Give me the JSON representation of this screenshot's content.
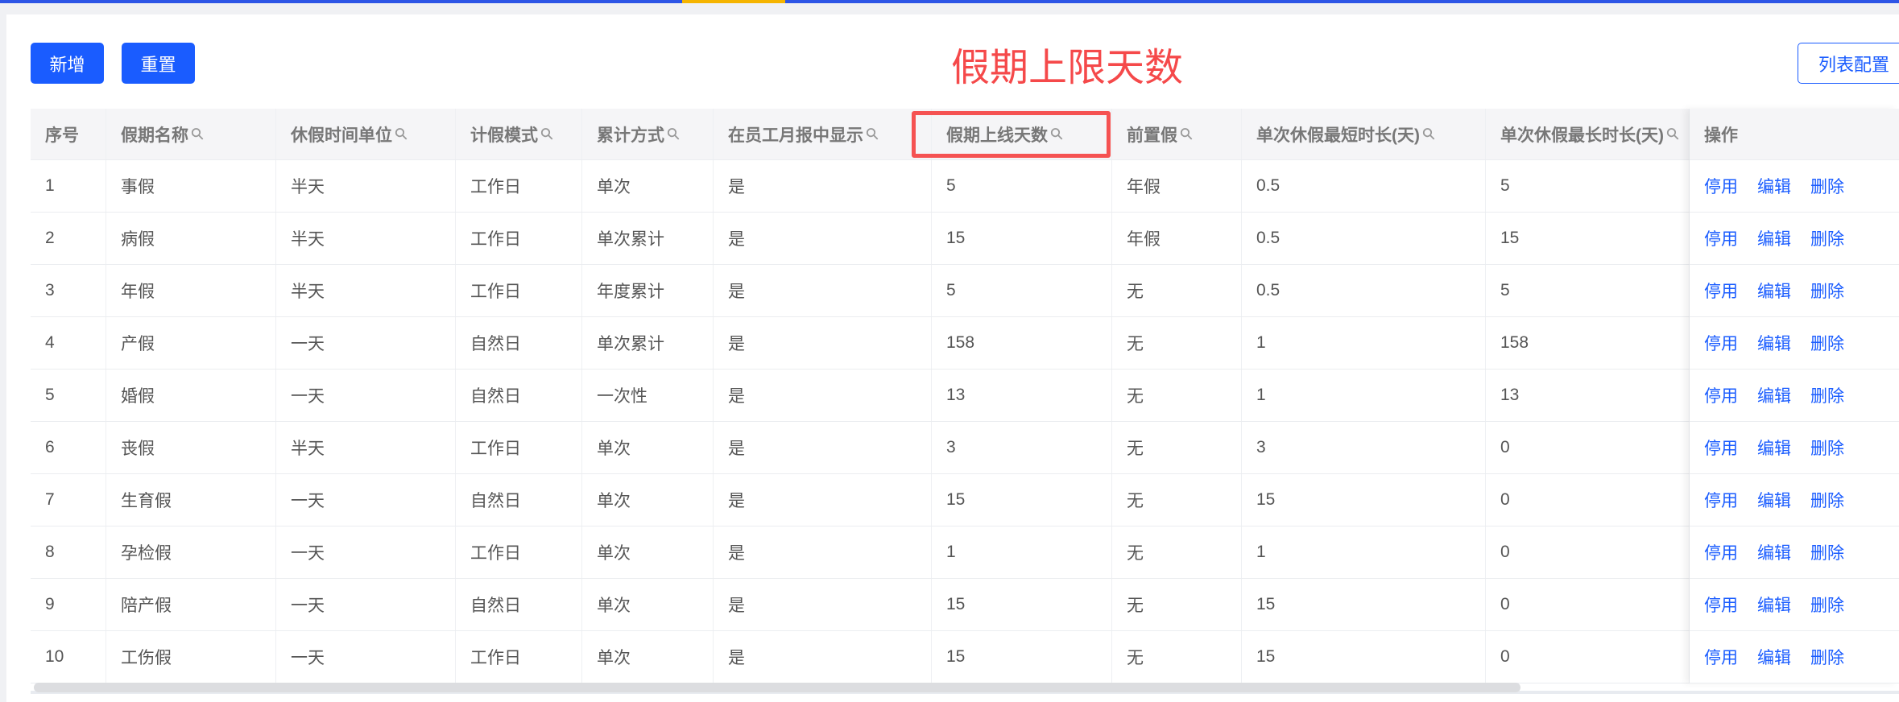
{
  "toolbar": {
    "add": "新增",
    "reset": "重置",
    "list_config": "列表配置"
  },
  "annotation": "假期上限天数",
  "columns": [
    "序号",
    "假期名称",
    "休假时间单位",
    "计假模式",
    "累计方式",
    "在员工月报中显示",
    "假期上线天数",
    "前置假",
    "单次休假最短时长(天)",
    "单次休假最长时长(天)",
    "操作"
  ],
  "actions": {
    "disable": "停用",
    "edit": "编辑",
    "delete": "删除"
  },
  "rows": [
    [
      "1",
      "事假",
      "半天",
      "工作日",
      "单次",
      "是",
      "5",
      "年假",
      "0.5",
      "5"
    ],
    [
      "2",
      "病假",
      "半天",
      "工作日",
      "单次累计",
      "是",
      "15",
      "年假",
      "0.5",
      "15"
    ],
    [
      "3",
      "年假",
      "半天",
      "工作日",
      "年度累计",
      "是",
      "5",
      "无",
      "0.5",
      "5"
    ],
    [
      "4",
      "产假",
      "一天",
      "自然日",
      "单次累计",
      "是",
      "158",
      "无",
      "1",
      "158"
    ],
    [
      "5",
      "婚假",
      "一天",
      "自然日",
      "一次性",
      "是",
      "13",
      "无",
      "1",
      "13"
    ],
    [
      "6",
      "丧假",
      "半天",
      "工作日",
      "单次",
      "是",
      "3",
      "无",
      "3",
      "0"
    ],
    [
      "7",
      "生育假",
      "一天",
      "自然日",
      "单次",
      "是",
      "15",
      "无",
      "15",
      "0"
    ],
    [
      "8",
      "孕检假",
      "一天",
      "工作日",
      "单次",
      "是",
      "1",
      "无",
      "1",
      "0"
    ],
    [
      "9",
      "陪产假",
      "一天",
      "自然日",
      "单次",
      "是",
      "15",
      "无",
      "15",
      "0"
    ],
    [
      "10",
      "工伤假",
      "一天",
      "工作日",
      "单次",
      "是",
      "15",
      "无",
      "15",
      "0"
    ]
  ]
}
